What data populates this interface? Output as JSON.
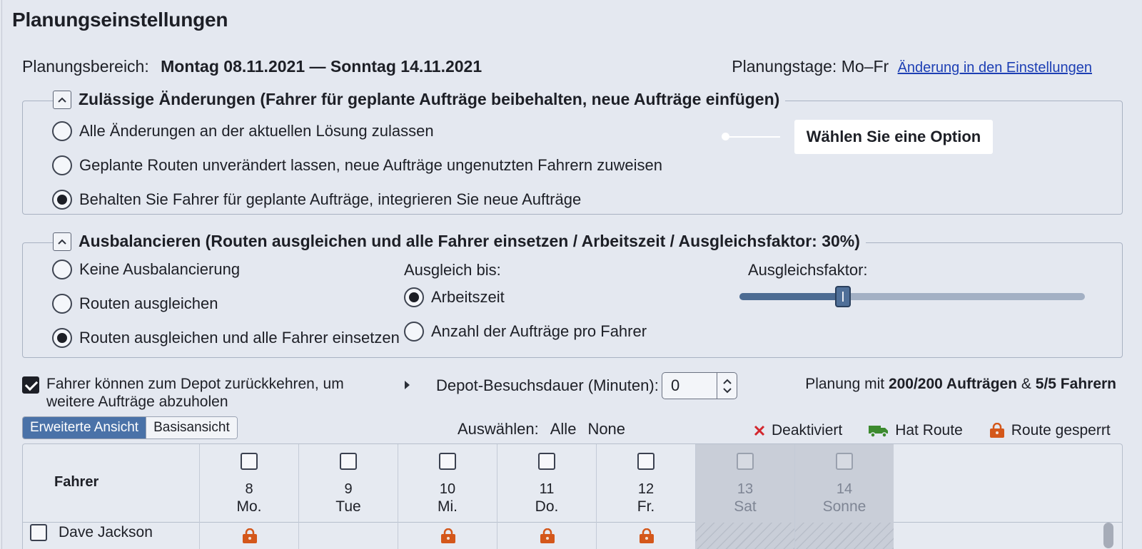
{
  "title": "Planungseinstellungen",
  "planning_range": {
    "label": "Planungsbereich:",
    "value": "Montag 08.11.2021 — Sonntag 14.11.2021"
  },
  "planning_days": {
    "label": "Planungstage:",
    "value": "Mo–Fr",
    "link": "Änderung in den Einstellungen"
  },
  "changes_section": {
    "title": "Zulässige Änderungen (Fahrer für geplante Aufträge beibehalten, neue Aufträge einfügen)",
    "options": [
      {
        "label": "Alle Änderungen an der aktuellen Lösung zulassen",
        "selected": false
      },
      {
        "label": "Geplante Routen unverändert lassen, neue Aufträge ungenutzten Fahrern zuweisen",
        "selected": false
      },
      {
        "label": "Behalten Sie Fahrer für geplante Aufträge, integrieren Sie neue Aufträge",
        "selected": true
      }
    ],
    "tooltip": "Wählen Sie eine Option"
  },
  "balance_section": {
    "title": "Ausbalancieren (Routen ausgleichen und alle Fahrer einsetzen / Arbeitszeit / Ausgleichsfaktor: 30%)",
    "options": [
      {
        "label": "Keine Ausbalancierung",
        "selected": false
      },
      {
        "label": "Routen ausgleichen",
        "selected": false
      },
      {
        "label": "Routen ausgleichen und alle Fahrer einsetzen",
        "selected": true
      }
    ],
    "balance_until_label": "Ausgleich bis:",
    "balance_until_options": [
      {
        "label": "Arbeitszeit",
        "selected": true
      },
      {
        "label": "Anzahl der Aufträge pro Fahrer",
        "selected": false
      }
    ],
    "factor_label": "Ausgleichsfaktor:",
    "factor_value": 0.3
  },
  "return_to_depot": {
    "label": "Fahrer können zum Depot zurückkehren, um weitere Aufträge abzuholen",
    "checked": true
  },
  "depot_visit": {
    "label": "Depot-Besuchsdauer (Minuten):",
    "value": "0"
  },
  "plan_summary": {
    "prefix": "Planung mit",
    "orders": "200/200 Aufträgen",
    "amp": "&",
    "drivers": "5/5 Fahrern"
  },
  "view_tabs": {
    "extended": "Erweiterte Ansicht",
    "basic": "Basisansicht"
  },
  "select": {
    "label": "Auswählen:",
    "all": "Alle",
    "none": "None"
  },
  "legend": {
    "deactivated": "Deaktiviert",
    "has_route": "Hat Route",
    "route_locked": "Route gesperrt"
  },
  "colors": {
    "accent": "#4a72a8",
    "deactivated": "#d3262d",
    "has_route": "#3c8a2e",
    "locked": "#d4571a"
  },
  "grid": {
    "driver_header": "Fahrer",
    "days": [
      {
        "num": "8",
        "name": "Mo.",
        "weekend": false
      },
      {
        "num": "9",
        "name": "Tue",
        "weekend": false
      },
      {
        "num": "10",
        "name": "Mi.",
        "weekend": false
      },
      {
        "num": "11",
        "name": "Do.",
        "weekend": false
      },
      {
        "num": "12",
        "name": "Fr.",
        "weekend": false
      },
      {
        "num": "13",
        "name": "Sat",
        "weekend": true
      },
      {
        "num": "14",
        "name": "Sonne",
        "weekend": true
      }
    ],
    "drivers": [
      {
        "name": "Dave Jackson",
        "locked_days": [
          0,
          2,
          3,
          4
        ]
      }
    ]
  }
}
